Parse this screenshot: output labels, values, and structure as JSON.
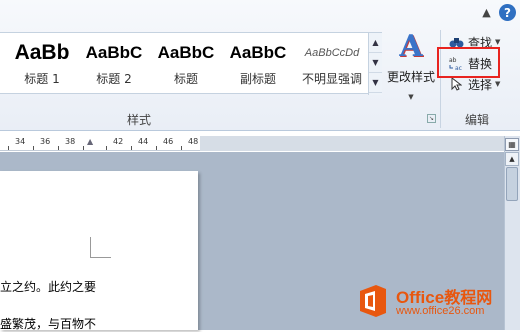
{
  "ribbon": {
    "minimize_icon": "caret-up-icon",
    "help_glyph": "?",
    "styles_group": {
      "label": "样式",
      "tiles": [
        {
          "sample": "AaBb",
          "name": "标题 1"
        },
        {
          "sample": "AaBbC",
          "name": "标题 2"
        },
        {
          "sample": "AaBbC",
          "name": "标题"
        },
        {
          "sample": "AaBbC",
          "name": "副标题"
        },
        {
          "sample": "AaBbCcDd",
          "name": "不明显强调"
        }
      ],
      "change_styles_label": "更改样式",
      "change_styles_glyph": "A"
    },
    "editing_group": {
      "label": "编辑",
      "find_label": "查找",
      "replace_label": "替换",
      "select_label": "选择",
      "replace_icon_text": "ab\nac"
    },
    "highlight_color": "#e8231f"
  },
  "ruler": {
    "numbers": [
      "34",
      "36",
      "38",
      "42",
      "44",
      "46",
      "48"
    ]
  },
  "document": {
    "lines": [
      "立之约。此约之要",
      "盛繁茂，与百物不"
    ]
  },
  "watermark": {
    "brand": "Office",
    "brand_cn": "教程网",
    "url": "www.office26.com",
    "logo_color": "#e8570f"
  }
}
